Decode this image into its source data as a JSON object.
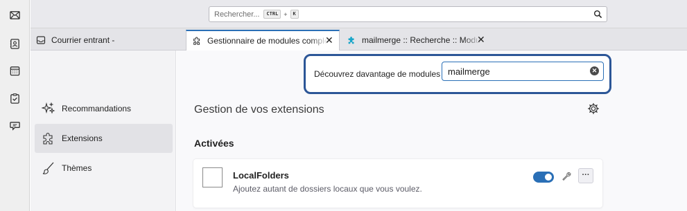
{
  "spaces_toolbar": {
    "items": [
      {
        "name": "mail"
      },
      {
        "name": "address-book"
      },
      {
        "name": "calendar"
      },
      {
        "name": "tasks"
      },
      {
        "name": "chat"
      }
    ]
  },
  "search": {
    "placeholder": "Rechercher...",
    "shortcut_key1": "CTRL",
    "shortcut_plus": "+",
    "shortcut_key2": "K"
  },
  "tabs": [
    {
      "title": "Courrier entrant -",
      "active": false
    },
    {
      "title": "Gestionnaire de modules compléme",
      "active": true
    },
    {
      "title": "mailmerge :: Recherche :: Modules p",
      "active": false
    }
  ],
  "addon_nav": {
    "items": [
      {
        "label": "Recommandations"
      },
      {
        "label": "Extensions",
        "selected": true
      },
      {
        "label": "Thèmes"
      }
    ]
  },
  "discover": {
    "label": "Découvrez davantage de modules",
    "value": "mailmerge"
  },
  "main": {
    "heading": "Gestion de vos extensions",
    "section_heading": "Activées"
  },
  "addon": {
    "name": "LocalFolders",
    "description": "Ajoutez autant de dossiers locaux que vous voulez.",
    "more_label": "···",
    "enabled": true
  },
  "colors": {
    "accent": "#2a6fb6",
    "highlight_border": "#2c5697"
  }
}
